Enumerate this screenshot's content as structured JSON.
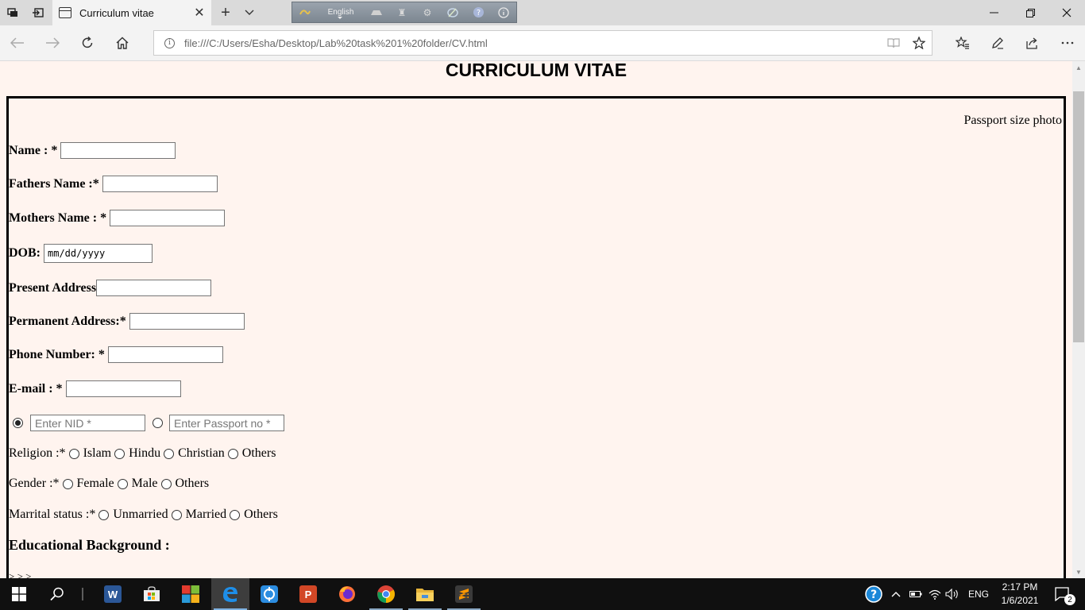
{
  "browser": {
    "tab_title": "Curriculum vitae",
    "url": "file:///C:/Users/Esha/Desktop/Lab%20task%201%20folder/CV.html",
    "language_bar_label": "English"
  },
  "page": {
    "title": "CURRICULUM VITAE",
    "photo_text": "Passport size photo",
    "fields": [
      {
        "label": "Name : *"
      },
      {
        "label": "Fathers Name :*"
      },
      {
        "label": "Mothers Name : *"
      },
      {
        "label": "DOB:",
        "value": "mm/dd/yyyy"
      },
      {
        "label": "Present Address"
      },
      {
        "label": "Permanent Address:*"
      },
      {
        "label": "Phone Number: *"
      },
      {
        "label": "E-mail : *"
      }
    ],
    "id_choice": {
      "nid_placeholder": "Enter NID *",
      "passport_placeholder": "Enter Passport no *",
      "selected": "nid"
    },
    "religion": {
      "label": "Religion :*",
      "options": [
        "Islam",
        "Hindu",
        "Christian",
        "Others"
      ]
    },
    "gender": {
      "label": "Gender :*",
      "options": [
        "Female",
        "Male",
        "Others"
      ]
    },
    "marital": {
      "label": "Marrital status :*",
      "options": [
        "Unmarried",
        "Married",
        "Others"
      ]
    },
    "education_heading": "Educational Background :",
    "cut_text": "> > >"
  },
  "taskbar": {
    "time": "2:17 PM",
    "date": "1/6/2021",
    "language": "ENG",
    "notification_count": "2"
  }
}
